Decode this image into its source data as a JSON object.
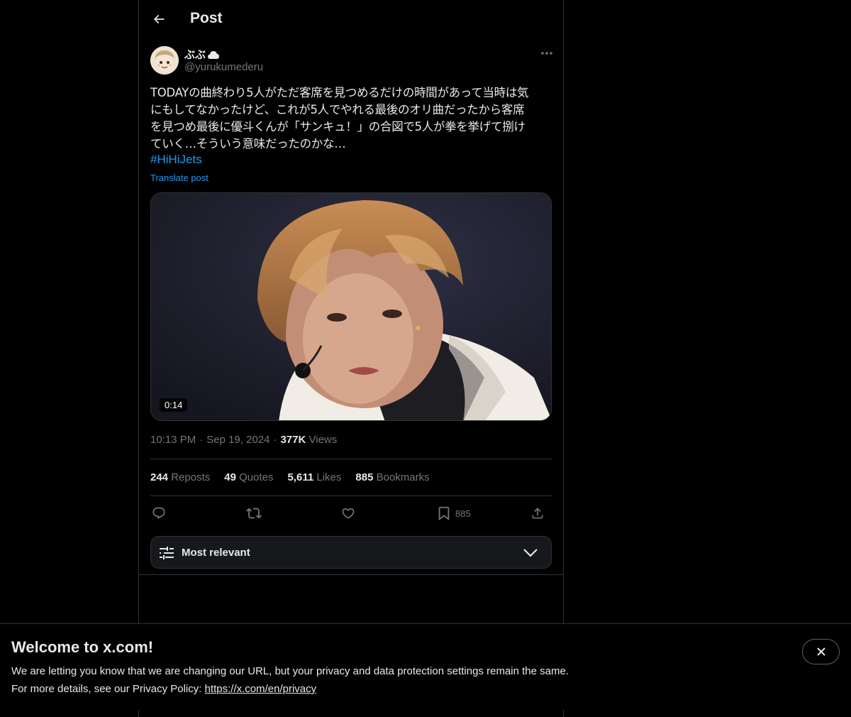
{
  "header": {
    "title": "Post"
  },
  "author": {
    "display_name": "ぶぶ",
    "handle": "@yurukumederu"
  },
  "post": {
    "lines": [
      "TODAYの曲終わり5人がただ客席を見つめるだけの時間があって当時は気",
      "にもしてなかったけど、これが5人でやれる最後のオリ曲だったから客席",
      "を見つめ最後に優斗くんが「サンキュ！」の合図で5人が拳を挙げて捌け",
      "ていく…そういう意味だったのかな…"
    ],
    "hashtag": "#HiHiJets",
    "translate_label": "Translate post",
    "video_duration": "0:14"
  },
  "meta": {
    "time": "10:13 PM",
    "date": "Sep 19, 2024",
    "views_count": "377K",
    "views_label": "Views"
  },
  "stats": {
    "reposts_count": "244",
    "reposts_label": "Reposts",
    "quotes_count": "49",
    "quotes_label": "Quotes",
    "likes_count": "5,611",
    "likes_label": "Likes",
    "bookmarks_count": "885",
    "bookmarks_label": "Bookmarks"
  },
  "actions": {
    "bookmark_count": "885"
  },
  "sort": {
    "label": "Most relevant"
  },
  "banner": {
    "title": "Welcome to x.com!",
    "line1": "We are letting you know that we are changing our URL, but your privacy and data protection settings remain the same.",
    "line2_prefix": "For more details, see our Privacy Policy: ",
    "link": "https://x.com/en/privacy"
  },
  "colors": {
    "accent": "#1d9bf0",
    "text": "#e7e9ea",
    "muted": "#71767b",
    "border": "#2f3336"
  }
}
